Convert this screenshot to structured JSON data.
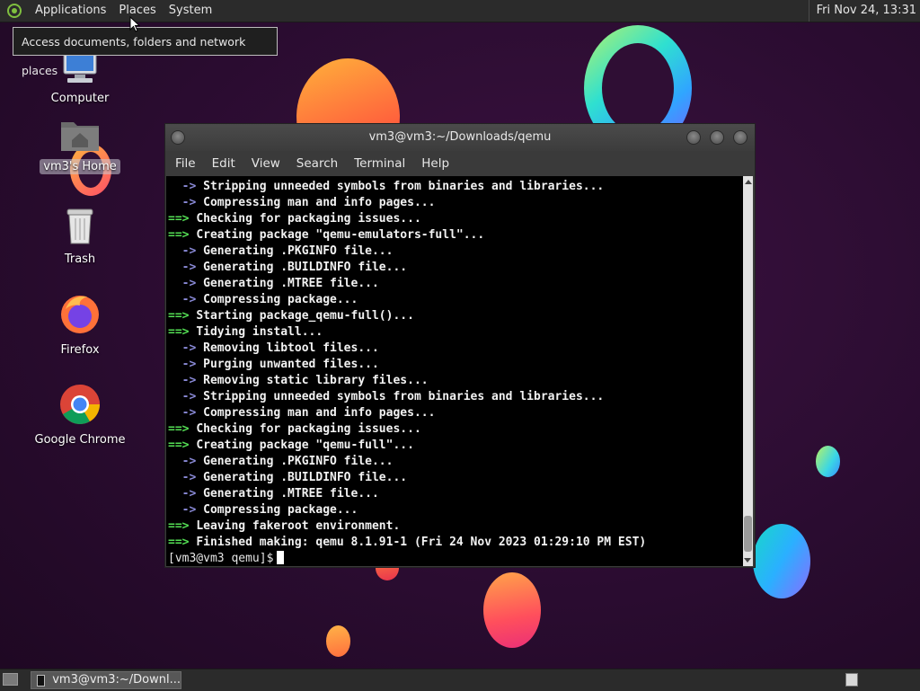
{
  "top_panel": {
    "menus": [
      "Applications",
      "Places",
      "System"
    ],
    "clock": "Fri Nov 24, 13:31"
  },
  "tooltip": "Access documents, folders and network places",
  "desktop_icons": [
    {
      "label": "Computer",
      "icon": "computer-icon"
    },
    {
      "label": "vm3's Home",
      "icon": "home-folder-icon"
    },
    {
      "label": "Trash",
      "icon": "trash-icon"
    },
    {
      "label": "Firefox",
      "icon": "firefox-icon"
    },
    {
      "label": "Google Chrome",
      "icon": "chrome-icon"
    }
  ],
  "terminal": {
    "title": "vm3@vm3:~/Downloads/qemu",
    "menus": [
      "File",
      "Edit",
      "View",
      "Search",
      "Terminal",
      "Help"
    ],
    "lines": [
      {
        "marker": "  ->",
        "text": "Stripping unneeded symbols from binaries and libraries..."
      },
      {
        "marker": "  ->",
        "text": "Compressing man and info pages..."
      },
      {
        "marker": "==>",
        "text": "Checking for packaging issues..."
      },
      {
        "marker": "==>",
        "text": "Creating package \"qemu-emulators-full\"..."
      },
      {
        "marker": "  ->",
        "text": "Generating .PKGINFO file..."
      },
      {
        "marker": "  ->",
        "text": "Generating .BUILDINFO file..."
      },
      {
        "marker": "  ->",
        "text": "Generating .MTREE file..."
      },
      {
        "marker": "  ->",
        "text": "Compressing package..."
      },
      {
        "marker": "==>",
        "text": "Starting package_qemu-full()..."
      },
      {
        "marker": "==>",
        "text": "Tidying install..."
      },
      {
        "marker": "  ->",
        "text": "Removing libtool files..."
      },
      {
        "marker": "  ->",
        "text": "Purging unwanted files..."
      },
      {
        "marker": "  ->",
        "text": "Removing static library files..."
      },
      {
        "marker": "  ->",
        "text": "Stripping unneeded symbols from binaries and libraries..."
      },
      {
        "marker": "  ->",
        "text": "Compressing man and info pages..."
      },
      {
        "marker": "==>",
        "text": "Checking for packaging issues..."
      },
      {
        "marker": "==>",
        "text": "Creating package \"qemu-full\"..."
      },
      {
        "marker": "  ->",
        "text": "Generating .PKGINFO file..."
      },
      {
        "marker": "  ->",
        "text": "Generating .BUILDINFO file..."
      },
      {
        "marker": "  ->",
        "text": "Generating .MTREE file..."
      },
      {
        "marker": "  ->",
        "text": "Compressing package..."
      },
      {
        "marker": "==>",
        "text": "Leaving fakeroot environment."
      },
      {
        "marker": "==>",
        "text": "Finished making: qemu 8.1.91-1 (Fri 24 Nov 2023 01:29:10 PM EST)"
      }
    ],
    "prompt": "[vm3@vm3 qemu]$"
  },
  "taskbar": {
    "window_label": "vm3@vm3:~/Downl..."
  }
}
